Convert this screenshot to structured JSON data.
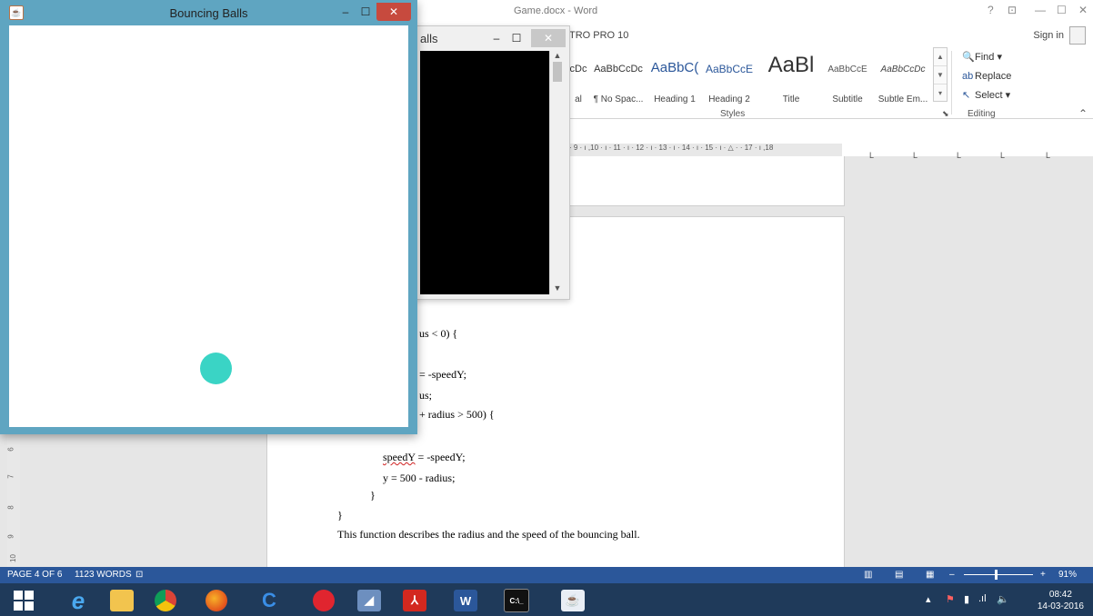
{
  "word": {
    "doc_title": "Game.docx - Word",
    "tab_fragment": "TRO PRO 10",
    "sign_in": "Sign in",
    "title_controls": {
      "help": "?",
      "ribbon_opts": "⊡",
      "min": "—",
      "max": "☐",
      "close": "✕"
    },
    "styles": [
      {
        "preview": "cDc",
        "name": "al"
      },
      {
        "preview": "AaBbCcDc",
        "name": "¶ No Spac..."
      },
      {
        "preview": "AaBbC(",
        "name": "Heading 1"
      },
      {
        "preview": "AaBbCcE",
        "name": "Heading 2"
      },
      {
        "preview": "AaBl",
        "name": "Title"
      },
      {
        "preview": "AaBbCcE",
        "name": "Subtitle"
      },
      {
        "preview": "AaBbCcDc",
        "name": "Subtle Em..."
      }
    ],
    "styles_group": "Styles",
    "editing": {
      "find": "Find ▾",
      "replace": "Replace",
      "select": "Select ▾",
      "group": "Editing"
    },
    "ruler": "· 9 · ı ,10 · ı · 11 · ı · 12 · ı · 13 · ı · 14 · ı · 15 · ı · △ · · 17 · ı ,18",
    "vruler": [
      "6",
      "7",
      "8",
      "9",
      "10"
    ],
    "code_lines": {
      "l1": "us < 0) {",
      "l2": "= -speedY;",
      "l3": "us;",
      "l4": "+ radius > 500) {",
      "l5a": "speedY",
      "l5b": " = -speedY;",
      "l6": "y = 500 - radius;",
      "l7": "}",
      "l8": "}",
      "l9": "This function describes the radius and the speed of the bouncing ball."
    },
    "status": {
      "page": "PAGE 4 OF 6",
      "words": "1123 WORDS",
      "zoom": "91%"
    }
  },
  "java_front": {
    "title": "Bouncing Balls"
  },
  "java_back": {
    "title_fragment": "alls"
  },
  "taskbar": {
    "time": "08:42",
    "date": "14-03-2016"
  },
  "colors": {
    "ball": "#3ad4c5",
    "java_frame": "#5fa5c1",
    "word_blue": "#2b579a",
    "taskbar": "#1f3a5a"
  }
}
